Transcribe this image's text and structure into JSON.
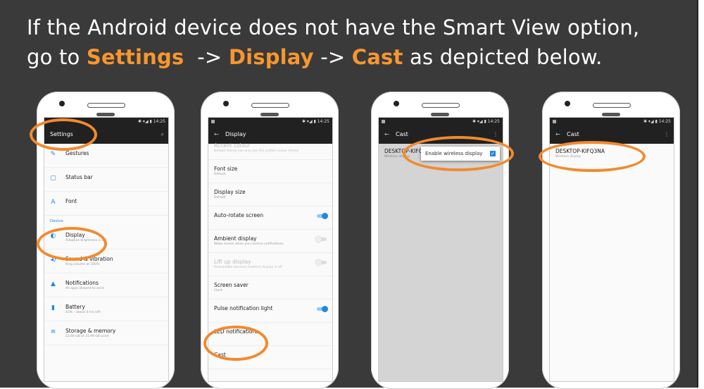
{
  "title": {
    "line1": "If the Android device does not have the Smart View option,",
    "go_to": "go to ",
    "settings": "Settings",
    "arrow1": "  -> ",
    "display": "Display",
    "arrow2": " -> ",
    "cast": "Cast",
    "tail": " as depicted below."
  },
  "status_time": "14:25",
  "status_icons": "✱ ▾◢ ▮",
  "phone1": {
    "title": "Settings",
    "search_icon": "search-icon",
    "items": [
      {
        "label": "Gestures",
        "sub": "",
        "icon": "✎"
      },
      {
        "label": "Status bar",
        "sub": "",
        "icon": "▢"
      },
      {
        "label": "Font",
        "sub": "",
        "icon": "A"
      }
    ],
    "section": "Device",
    "device_items": [
      {
        "label": "Display",
        "sub": "Adaptive brightness is off",
        "icon": "◐"
      },
      {
        "label": "Sound & vibration",
        "sub": "Ring volume at 100%",
        "icon": "◂)"
      },
      {
        "label": "Notifications",
        "sub": "All apps allowed to send",
        "icon": "▲"
      },
      {
        "label": "Battery",
        "sub": "43% – about 4 hrs left",
        "icon": "▮"
      },
      {
        "label": "Storage & memory",
        "sub": "22.84 GB of 31.99 GB used",
        "icon": "≡"
      }
    ]
  },
  "phone2": {
    "back": "←",
    "title": "Display",
    "items": [
      {
        "label": "Accent colour",
        "sub": "Default theme can only use the system colour theme",
        "dim": true,
        "toggle": ""
      },
      {
        "label": "Font size",
        "sub": "Default",
        "dim": false,
        "toggle": ""
      },
      {
        "label": "Display size",
        "sub": "Default",
        "dim": false,
        "toggle": ""
      },
      {
        "label": "Auto-rotate screen",
        "sub": "",
        "dim": false,
        "toggle": "on"
      },
      {
        "label": "Ambient display",
        "sub": "Wake screen when you receive notifications",
        "dim": false,
        "toggle": "off"
      },
      {
        "label": "Lift up display",
        "sub": "Unavailable because ambient display is off",
        "dim": true,
        "toggle": "off"
      },
      {
        "label": "Screen saver",
        "sub": "Clock",
        "dim": false,
        "toggle": ""
      },
      {
        "label": "Pulse notification light",
        "sub": "",
        "dim": false,
        "toggle": "on"
      },
      {
        "label": "LED notifications",
        "sub": "",
        "dim": false,
        "toggle": ""
      },
      {
        "label": "Cast",
        "sub": "",
        "dim": false,
        "toggle": ""
      }
    ]
  },
  "phone3": {
    "back": "←",
    "title": "Cast",
    "more": "⋮",
    "device": "DESKTOP-KIFQ3NA",
    "device_sub": "Wireless display",
    "menu_label": "Enable wireless display",
    "check": "✓"
  },
  "phone4": {
    "back": "←",
    "title": "Cast",
    "more": "⋮",
    "device": "DESKTOP-KIFQ3NA",
    "device_sub": "Wireless display"
  },
  "colors": {
    "highlight": "#f7962f",
    "ring": "#f28a2e",
    "accent": "#1e88e5",
    "slide_bg": "#3a3a3a"
  }
}
